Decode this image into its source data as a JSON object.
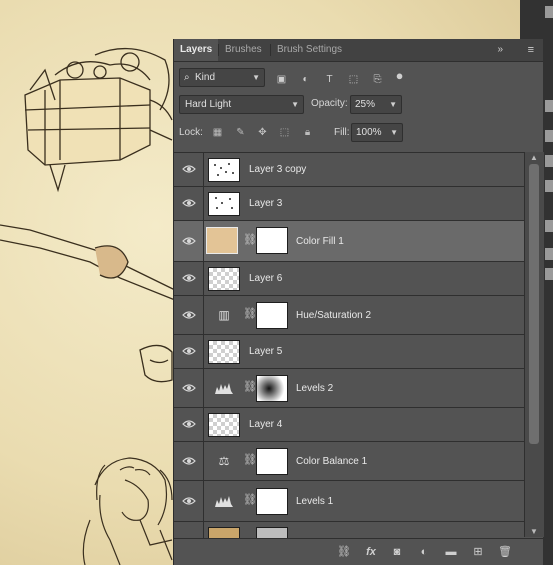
{
  "tabs": {
    "layers": "Layers",
    "brushes": "Brushes",
    "brush_settings": "Brush Settings",
    "collapse": "»",
    "menu": "≡"
  },
  "filter": {
    "kind_label": "Kind",
    "search_glyph": "⌕"
  },
  "blend": {
    "mode": "Hard Light",
    "opacity_label": "Opacity:",
    "opacity_value": "25%"
  },
  "lock": {
    "label": "Lock:",
    "fill_label": "Fill:",
    "fill_value": "100%"
  },
  "layers": [
    {
      "name": "Layer 3 copy",
      "type": "pixel",
      "selected": false
    },
    {
      "name": "Layer 3",
      "type": "pixel",
      "selected": false
    },
    {
      "name": "Color Fill 1",
      "type": "fill",
      "selected": true,
      "fill_color": "#e3c496"
    },
    {
      "name": "Layer 6",
      "type": "transparent",
      "selected": false
    },
    {
      "name": "Hue/Saturation 2",
      "type": "adjustment",
      "icon": "hue-saturation-icon",
      "selected": false
    },
    {
      "name": "Layer 5",
      "type": "transparent",
      "selected": false
    },
    {
      "name": "Levels 2",
      "type": "adjustment",
      "icon": "levels-icon",
      "selected": false
    },
    {
      "name": "Layer 4",
      "type": "transparent",
      "selected": false
    },
    {
      "name": "Color Balance 1",
      "type": "adjustment",
      "icon": "color-balance-icon",
      "selected": false
    },
    {
      "name": "Levels 1",
      "type": "adjustment",
      "icon": "levels-icon",
      "selected": false
    }
  ],
  "colors": {
    "panel_bg": "#535353",
    "selected_row": "#6a6a6a",
    "canvas_paper": "#eadcb0"
  }
}
